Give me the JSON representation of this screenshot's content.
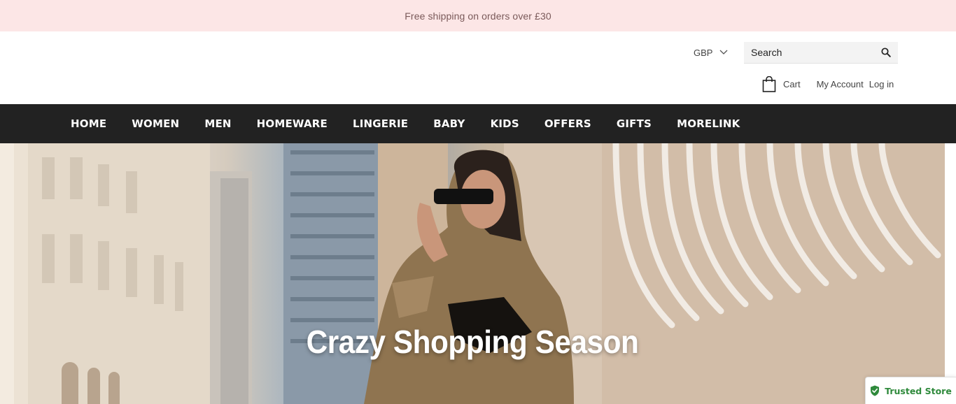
{
  "announcement": {
    "text": "Free shipping on orders over £30"
  },
  "header": {
    "currency": "GBP",
    "search_placeholder": "Search",
    "cart_label": "Cart",
    "my_account_label": "My Account",
    "login_label": "Log in"
  },
  "nav": {
    "items": [
      {
        "label": "HOME"
      },
      {
        "label": "WOMEN"
      },
      {
        "label": "MEN"
      },
      {
        "label": "HOMEWARE"
      },
      {
        "label": "LINGERIE"
      },
      {
        "label": "BABY"
      },
      {
        "label": "KIDS"
      },
      {
        "label": "OFFERS"
      },
      {
        "label": "GIFTS"
      },
      {
        "label": "MORELINK"
      }
    ]
  },
  "hero": {
    "title": "Crazy Shopping Season"
  },
  "trusted_badge": {
    "label": "Trusted Store"
  },
  "colors": {
    "announcement_bg": "#fce6e6",
    "nav_bg": "#222222",
    "trusted_green": "#2f8a3c"
  }
}
